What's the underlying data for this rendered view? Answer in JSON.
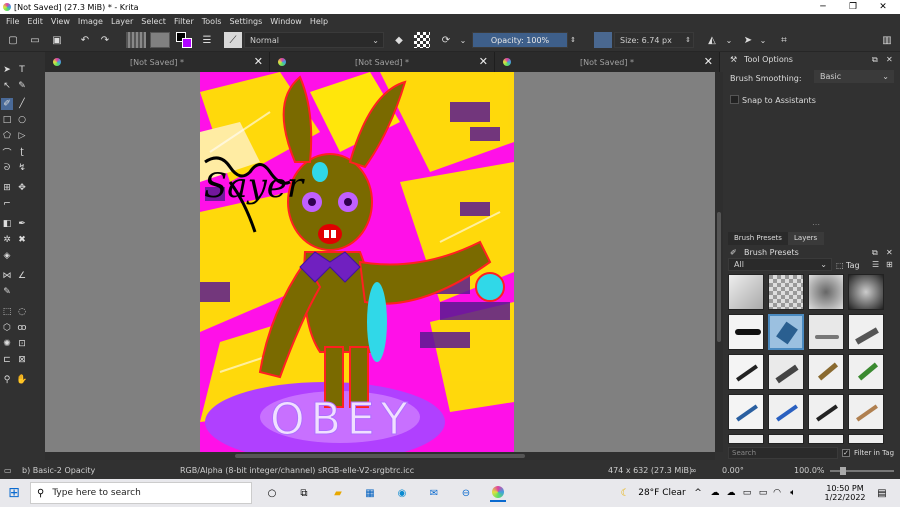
{
  "window": {
    "title": "[Not Saved]  (27.3 MiB)  * - Krita"
  },
  "menu": [
    "File",
    "Edit",
    "View",
    "Image",
    "Layer",
    "Select",
    "Filter",
    "Tools",
    "Settings",
    "Window",
    "Help"
  ],
  "toolbar": {
    "blend_mode": "Normal",
    "opacity": "Opacity: 100%",
    "size": "Size: 6.74 px"
  },
  "tabs": [
    {
      "label": "[Not Saved]  *"
    },
    {
      "label": "[Not Saved]  *"
    },
    {
      "label": "[Not Saved]  *"
    }
  ],
  "artwork": {
    "signature": "Sayer",
    "caption": "OBEY"
  },
  "tool_options": {
    "title": "Tool Options",
    "brush_smoothing_label": "Brush Smoothing:",
    "brush_smoothing_value": "Basic",
    "snap_label": "Snap to Assistants"
  },
  "dock_tabs": [
    "Brush Presets",
    "Layers"
  ],
  "brush_presets": {
    "title": "Brush Presets",
    "filter": "All",
    "tag": "Tag",
    "search_placeholder": "Search",
    "filter_in_tag": "Filter in Tag"
  },
  "status": {
    "brush": "b) Basic-2 Opacity",
    "color_space": "RGB/Alpha (8-bit integer/channel)  sRGB-elle-V2-srgbtrc.icc",
    "dimensions": "474 x 632 (27.3 MiB)",
    "rotation": "0.00°",
    "zoom": "100.0%"
  },
  "taskbar": {
    "search_placeholder": "Type here to search",
    "weather": "28°F  Clear",
    "time": "10:50 PM",
    "date": "1/22/2022"
  },
  "colors": {
    "accent": "#5a7aa8",
    "magenta": "#ff00e0",
    "yellow": "#ffe800",
    "olive": "#8a7a00",
    "red_line": "#ff2020"
  }
}
